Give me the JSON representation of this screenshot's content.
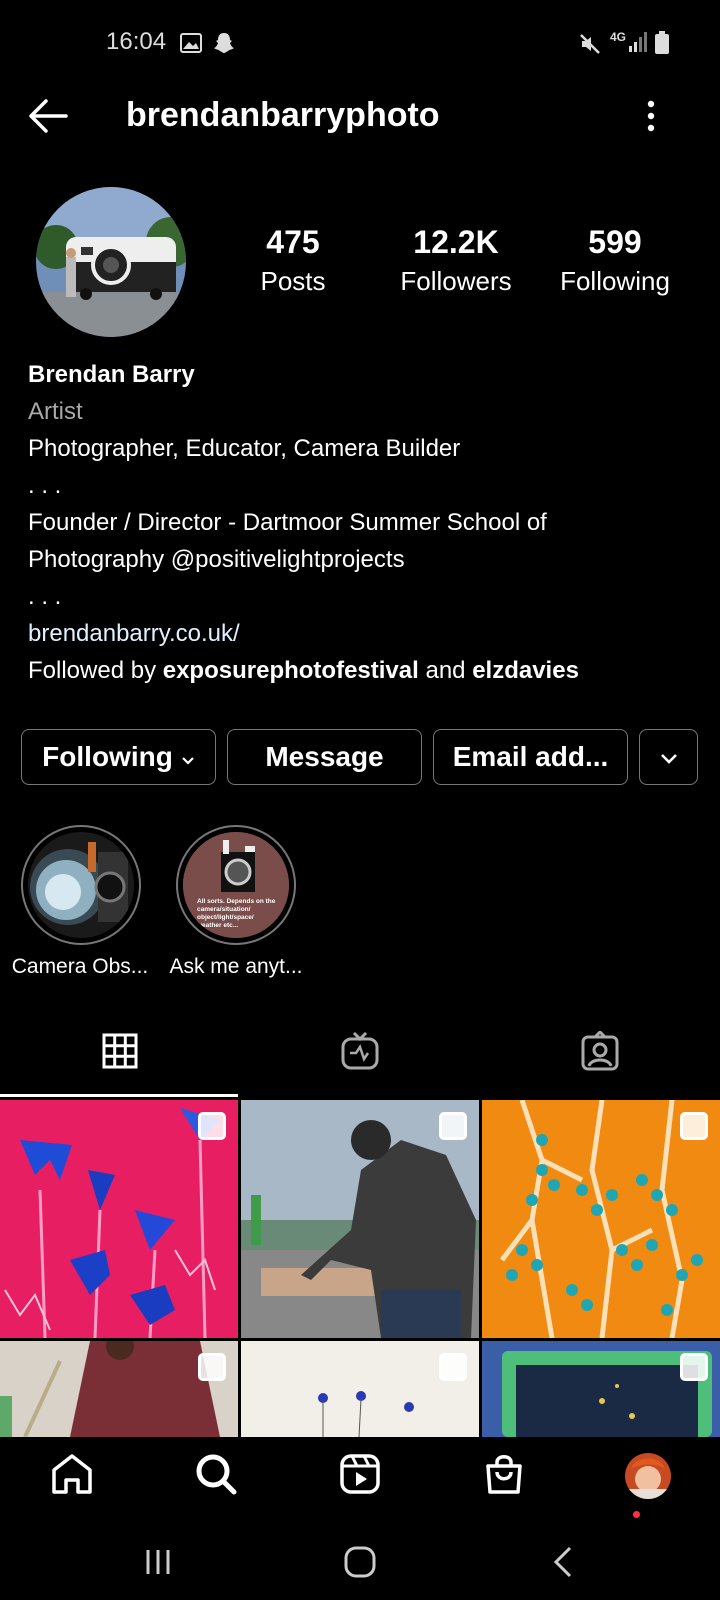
{
  "status": {
    "time": "16:04",
    "network": "4G"
  },
  "header": {
    "username": "brendanbarryphoto"
  },
  "profile": {
    "stats": [
      {
        "number": "475",
        "label": "Posts"
      },
      {
        "number": "12.2K",
        "label": "Followers"
      },
      {
        "number": "599",
        "label": "Following"
      }
    ],
    "name": "Brendan Barry",
    "category": "Artist",
    "bio_line1": "Photographer, Educator, Camera Builder",
    "bio_dots1": ". . .",
    "bio_line2": "Founder / Director - Dartmoor Summer School of",
    "bio_line3": "Photography @positivelightprojects",
    "bio_dots2": ". . .",
    "link": "brendanbarry.co.uk/",
    "followed_prefix": "Followed by ",
    "followed_user1": "exposurephotofestival",
    "followed_and": " and ",
    "followed_user2": "elzdavies"
  },
  "actions": {
    "following": "Following",
    "message": "Message",
    "email": "Email add..."
  },
  "highlights": [
    {
      "label": "Camera Obs..."
    },
    {
      "label": "Ask me anyt..."
    }
  ],
  "highlight2_text": "All sorts. Depends on the camera/situation/ object/light/space/ weather etc...",
  "colors": {
    "background": "#000000",
    "text": "#ffffff",
    "muted": "#a8a8a8",
    "border": "#777777",
    "notification": "#ff3040"
  }
}
